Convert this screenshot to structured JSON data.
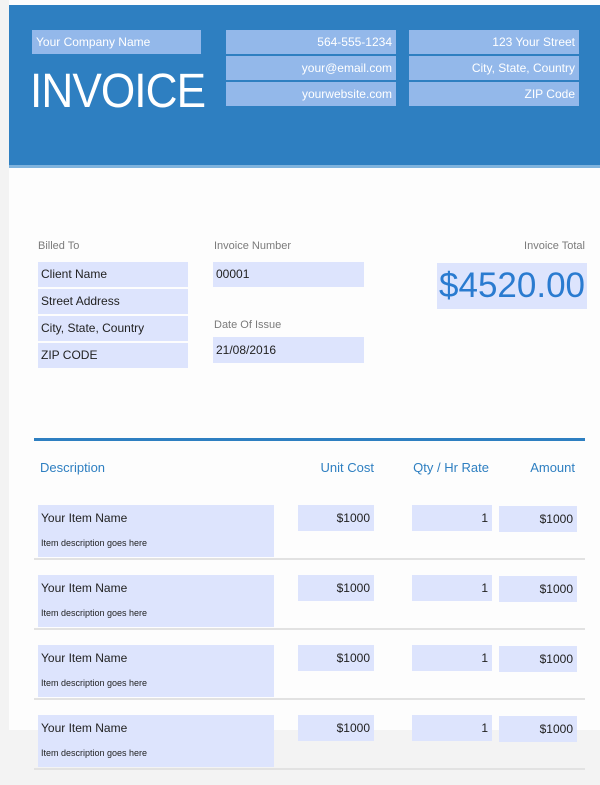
{
  "header": {
    "company_name": "Your Company Name",
    "title": "INVOICE",
    "contact": [
      "564-555-1234",
      "your@email.com",
      "yourwebsite.com"
    ],
    "address": [
      "123 Your Street",
      "City, State, Country",
      "ZIP Code"
    ]
  },
  "billed_to": {
    "label": "Billed To",
    "lines": [
      "Client Name",
      "Street Address",
      "City, State, Country",
      "ZIP CODE"
    ]
  },
  "invoice_number": {
    "label": "Invoice Number",
    "value": "00001"
  },
  "date_of_issue": {
    "label": "Date Of Issue",
    "value": "21/08/2016"
  },
  "invoice_total": {
    "label": "Invoice Total",
    "value": "$4520.00"
  },
  "table": {
    "headers": {
      "description": "Description",
      "unit_cost": "Unit Cost",
      "qty": "Qty / Hr Rate",
      "amount": "Amount"
    },
    "rows": [
      {
        "name": "Your Item Name",
        "description": "Item description goes here",
        "unit_cost": "$1000",
        "qty": "1",
        "amount": "$1000"
      },
      {
        "name": "Your Item Name",
        "description": "Item description goes here",
        "unit_cost": "$1000",
        "qty": "1",
        "amount": "$1000"
      },
      {
        "name": "Your Item Name",
        "description": "Item description goes here",
        "unit_cost": "$1000",
        "qty": "1",
        "amount": "$1000"
      },
      {
        "name": "Your Item Name",
        "description": "Item description goes here",
        "unit_cost": "$1000",
        "qty": "1",
        "amount": "$1000"
      }
    ]
  },
  "colors": {
    "brand": "#2e7fc1",
    "field_bg": "#dde4fd",
    "header_field_bg": "#93b8ea",
    "total_text": "#2a7bd0"
  }
}
